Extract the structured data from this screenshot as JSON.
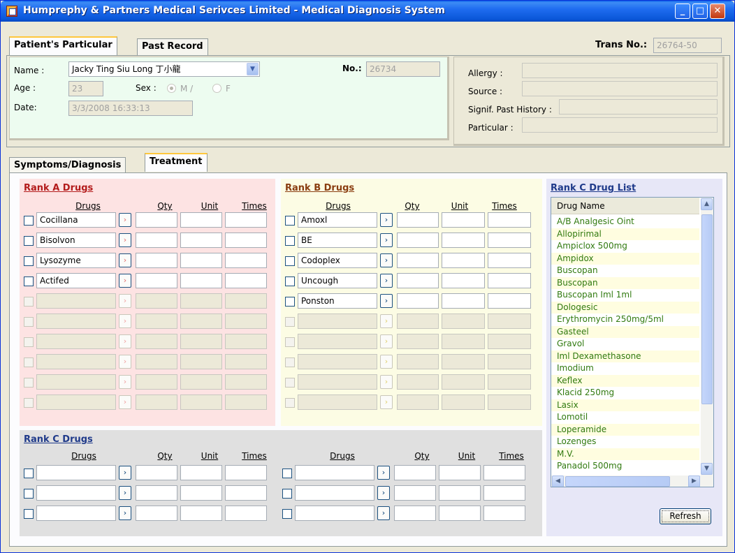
{
  "window": {
    "title": "Humprephy & Partners Medical Serivces Limited - Medical Diagnosis System",
    "min_glyph": "_",
    "max_glyph": "□",
    "close_glyph": "✕"
  },
  "top_tabs": [
    {
      "label": "Patient's Particular",
      "active": true
    },
    {
      "label": "Past Record",
      "active": false
    }
  ],
  "trans": {
    "label": "Trans No.:",
    "value": "26764-50"
  },
  "patient": {
    "name_label": "Name :",
    "name_value": "Jacky Ting Siu Long 丁小龍",
    "no_label": "No.:",
    "no_value": "26734",
    "age_label": "Age :",
    "age_value": "23",
    "sex_label": "Sex :",
    "sex_m": "M /",
    "sex_f": "F",
    "sex_selected": "M",
    "date_label": "Date:",
    "date_value": "3/3/2008 16:33:13"
  },
  "history": {
    "allergy_label": "Allergy :",
    "allergy_value": "",
    "source_label": "Source :",
    "source_value": "",
    "signif_label": "Signif. Past History :",
    "signif_value": "",
    "particular_label": "Particular :",
    "particular_value": ""
  },
  "main_tabs": [
    {
      "label": "Symptoms/Diagnosis",
      "active": false
    },
    {
      "label": "Treatment",
      "active": true
    }
  ],
  "colors": {
    "rank_a_bg": "#fde3e3",
    "rank_b_bg": "#fcfce4",
    "rank_c_bg": "#e0e0e0",
    "rank_c_list_bg": "#e7e7f7",
    "patient_bg": "#edfcf0",
    "rank_a_title": "#b31b1b",
    "rank_b_title": "#8a3d10",
    "rank_c_title": "#1f3a8a",
    "drug_text": "#317a10"
  },
  "columns": {
    "drugs": "Drugs",
    "qty": "Qty",
    "unit": "Unit",
    "times": "Times"
  },
  "rank_a": {
    "title": "Rank A Drugs",
    "drugs": [
      "Cocillana",
      "Bisolvon",
      "Lysozyme",
      "Actifed"
    ],
    "empty_rows": 6,
    "arrow_glyph": "›"
  },
  "rank_b": {
    "title": "Rank B Drugs",
    "drugs": [
      "Amoxl",
      "BE",
      "Codoplex",
      "Uncough",
      "Ponston"
    ],
    "empty_rows": 5
  },
  "rank_c": {
    "title": "Rank C Drugs",
    "left_rows": 3,
    "right_rows": 3
  },
  "rank_c_list": {
    "title": "Rank C Drug List",
    "header": "Drug Name",
    "items": [
      "A/B Analgesic Oint",
      "Allopirimal",
      "Ampiclox 500mg",
      "Ampidox",
      "Buscopan",
      "Buscopan",
      "Buscopan Iml 1ml",
      "Dologesic",
      "Erythromycin 250mg/5ml",
      "Gasteel",
      "Gravol",
      "Iml Dexamethasone",
      "Imodium",
      "Keflex",
      "Klacid 250mg",
      "Lasix",
      "Lomotil",
      "Loperamide",
      "Lozenges",
      "M.V.",
      "Panadol 500mg"
    ],
    "refresh_label": "Refresh"
  }
}
